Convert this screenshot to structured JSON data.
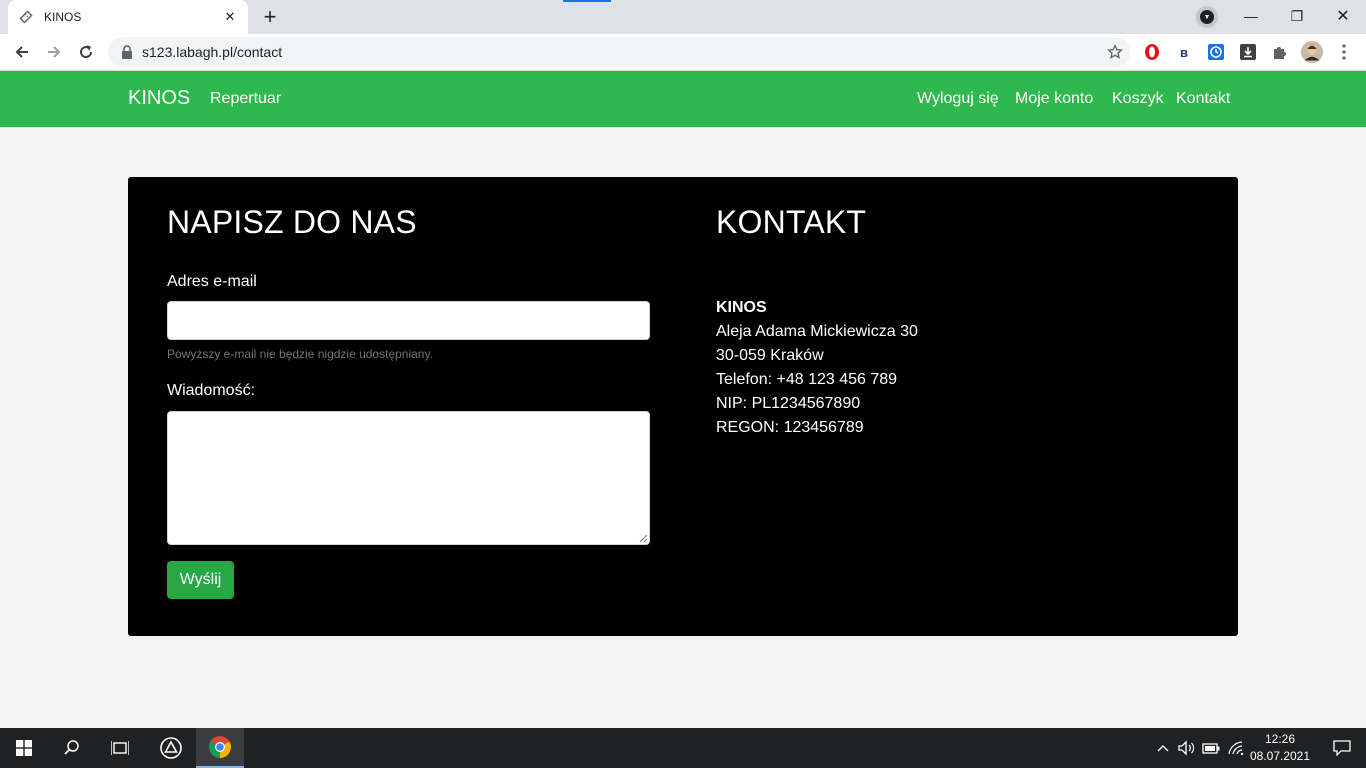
{
  "browser": {
    "tab_title": "KINOS",
    "tab_close": "✕",
    "new_tab": "+",
    "url": "s123.labagh.pl/contact",
    "window_controls": {
      "minimize": "—",
      "restore": "❐",
      "close": "✕"
    },
    "toolbar_icons": [
      "back-icon",
      "forward-icon",
      "reload-icon",
      "lock-icon",
      "star-icon"
    ],
    "extensions": [
      "opera-icon",
      "b-extension-icon",
      "timer-extension-icon",
      "download-extension-icon",
      "puzzle-icon",
      "profile-avatar",
      "menu-icon"
    ],
    "accent_color": "#1a73e8"
  },
  "navbar": {
    "brand": "KINOS",
    "left_links": [
      "Repertuar"
    ],
    "right_links": [
      "Wyloguj się",
      "Moje konto",
      "Koszyk",
      "Kontakt"
    ],
    "color": "#2eb84e"
  },
  "contact_form": {
    "heading": "NAPISZ DO NAS",
    "email_label": "Adres e-mail",
    "email_value": "",
    "email_help": "Powyższy e-mail nie będzie nigdzie udostępniany.",
    "message_label": "Wiadomość:",
    "message_value": "",
    "submit_label": "Wyślij",
    "submit_color": "#28a745"
  },
  "contact_info": {
    "heading": "KONTAKT",
    "company": "KINOS",
    "street": "Aleja Adama Mickiewicza 30",
    "city": "30-059 Kraków",
    "phone": "Telefon: +48 123 456 789",
    "nip": "NIP: PL1234567890",
    "regon": "REGON: 123456789"
  },
  "taskbar": {
    "time": "12:26",
    "date": "08.07.2021",
    "icons": [
      "windows-start-icon",
      "search-icon",
      "task-view-icon",
      "app-triangle-icon",
      "chrome-icon",
      "chevron-up-icon",
      "volume-icon",
      "battery-icon",
      "wifi-icon",
      "notifications-icon"
    ]
  }
}
